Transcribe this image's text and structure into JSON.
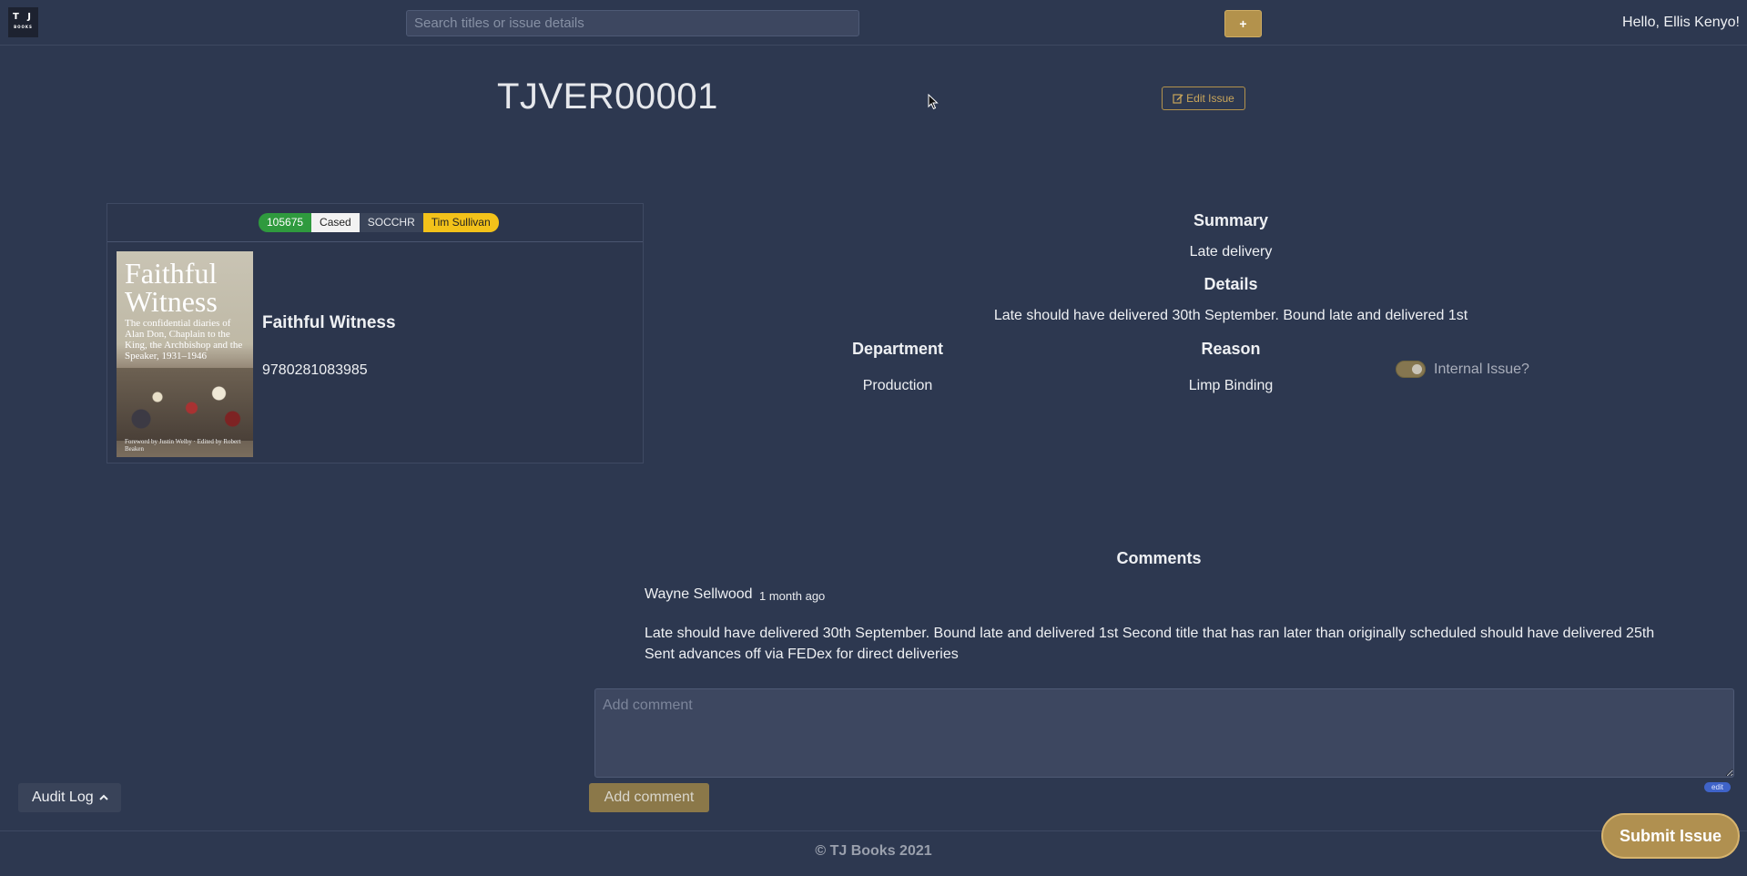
{
  "header": {
    "logo_top": "T J",
    "logo_bottom": "BOOKS",
    "search_placeholder": "Search titles or issue details",
    "add_label": "+",
    "greeting": "Hello, Ellis Kenyo!"
  },
  "issue": {
    "id": "TJVER00001",
    "edit_label": "Edit Issue"
  },
  "book": {
    "badges": [
      "105675",
      "Cased",
      "SOCCHR",
      "Tim Sullivan"
    ],
    "cover_title": "Faithful Witness",
    "cover_subtitle": "The confidential diaries of Alan Don, Chaplain to the King, the Archbishop and the Speaker, 1931–1946",
    "cover_credits": "Foreword by Justin Welby · Edited by Robert Beaken",
    "title": "Faithful Witness",
    "isbn": "9780281083985"
  },
  "details": {
    "summary_label": "Summary",
    "summary": "Late delivery",
    "details_label": "Details",
    "details": "Late should have delivered 30th September. Bound late and delivered 1st",
    "department_label": "Department",
    "department": "Production",
    "reason_label": "Reason",
    "reason": "Limp Binding",
    "internal_label": "Internal Issue?",
    "internal_on": true
  },
  "comments": {
    "heading": "Comments",
    "items": [
      {
        "author": "Wayne Sellwood",
        "time": "1 month ago",
        "text": "Late should have delivered 30th September. Bound late and delivered 1st Second title that has ran later than originally scheduled should have delivered 25th Sent advances off via FEDex for direct deliveries"
      }
    ],
    "placeholder": "Add comment",
    "edit_pill": "edit",
    "add_label": "Add comment"
  },
  "audit_label": "Audit Log",
  "footer": "© TJ Books 2021",
  "submit_label": "Submit Issue",
  "colors": {
    "background": "#2d3850",
    "accent": "#b3924c",
    "badge_green": "#2f9a3e",
    "badge_yellow": "#f3c21a"
  }
}
